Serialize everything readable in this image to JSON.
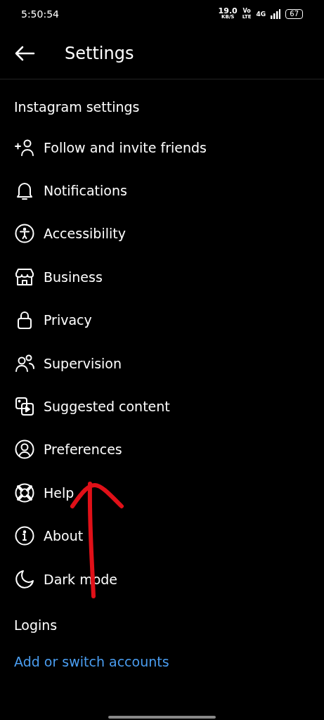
{
  "status_bar": {
    "time": "5:50:54",
    "speed": "19.0",
    "speed_unit": "KB/S",
    "volte_top": "Vo",
    "volte_bottom": "LTE",
    "network": "4G",
    "battery": "67"
  },
  "header": {
    "title": "Settings"
  },
  "sections": [
    {
      "title": "Instagram settings",
      "items": [
        {
          "label": "Follow and invite friends"
        },
        {
          "label": "Notifications"
        },
        {
          "label": "Accessibility"
        },
        {
          "label": "Business"
        },
        {
          "label": "Privacy"
        },
        {
          "label": "Supervision"
        },
        {
          "label": "Suggested content"
        },
        {
          "label": "Preferences"
        },
        {
          "label": "Help"
        },
        {
          "label": "About"
        },
        {
          "label": "Dark mode"
        }
      ]
    },
    {
      "title": "Logins",
      "links": [
        {
          "label": "Add or switch accounts"
        }
      ]
    }
  ]
}
